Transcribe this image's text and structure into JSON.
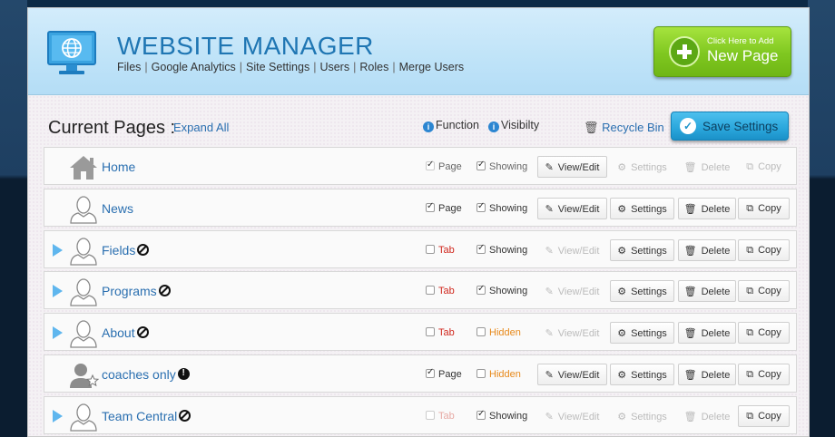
{
  "header": {
    "title": "WEBSITE MANAGER",
    "nav": [
      "Files",
      "Google Analytics",
      "Site Settings",
      "Users",
      "Roles",
      "Merge Users"
    ],
    "new_page_small": "Click Here to Add",
    "new_page_big": "New Page"
  },
  "toolbar": {
    "current_pages": "Current Pages :",
    "expand_all": "Expand All",
    "function": "Function",
    "visibility": "Visibilty",
    "recycle_bin": "Recycle Bin",
    "save_settings": "Save Settings"
  },
  "buttons": {
    "view_edit": "View/Edit",
    "settings": "Settings",
    "delete": "Delete",
    "copy": "Copy"
  },
  "rows": [
    {
      "name": "Home",
      "icon": "home-icon",
      "expand": false,
      "flag": "",
      "func": "Page",
      "func_checked": true,
      "func_color": "dim",
      "vis": "Showing",
      "vis_checked": true,
      "vis_color": "dim",
      "view": true,
      "settings": false,
      "delete": false,
      "copy": false
    },
    {
      "name": "News",
      "icon": "person-icon",
      "expand": false,
      "flag": "",
      "func": "Page",
      "func_checked": true,
      "func_color": "dark",
      "vis": "Showing",
      "vis_checked": true,
      "vis_color": "dark",
      "view": true,
      "settings": true,
      "delete": true,
      "copy": true
    },
    {
      "name": "Fields",
      "icon": "person-icon",
      "expand": true,
      "flag": "no",
      "func": "Tab",
      "func_checked": false,
      "func_color": "red",
      "vis": "Showing",
      "vis_checked": true,
      "vis_color": "dark",
      "view": false,
      "settings": true,
      "delete": true,
      "copy": true
    },
    {
      "name": "Programs",
      "icon": "person-icon",
      "expand": true,
      "flag": "no",
      "func": "Tab",
      "func_checked": false,
      "func_color": "red",
      "vis": "Showing",
      "vis_checked": true,
      "vis_color": "dark",
      "view": false,
      "settings": true,
      "delete": true,
      "copy": true
    },
    {
      "name": "About",
      "icon": "person-icon",
      "expand": true,
      "flag": "no",
      "func": "Tab",
      "func_checked": false,
      "func_color": "red",
      "vis": "Hidden",
      "vis_checked": false,
      "vis_color": "orange",
      "view": false,
      "settings": true,
      "delete": true,
      "copy": true
    },
    {
      "name": "coaches only",
      "icon": "person-star-icon",
      "expand": false,
      "flag": "warn",
      "func": "Page",
      "func_checked": true,
      "func_color": "dark",
      "vis": "Hidden",
      "vis_checked": false,
      "vis_color": "orange",
      "view": true,
      "settings": true,
      "delete": true,
      "copy": true
    },
    {
      "name": "Team Central",
      "icon": "person-icon",
      "expand": true,
      "flag": "no",
      "func": "Tab",
      "func_checked": false,
      "func_color": "red-dim",
      "vis": "Showing",
      "vis_checked": true,
      "vis_color": "dark",
      "view": false,
      "settings": false,
      "delete": false,
      "copy": true
    }
  ]
}
